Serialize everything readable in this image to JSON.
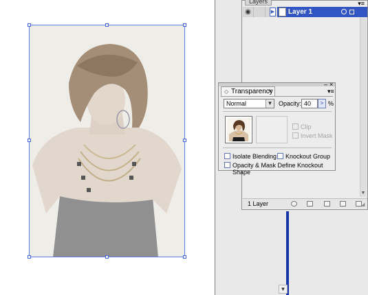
{
  "canvas": {
    "photo_alt": "",
    "selection_color": "#3d63d8"
  },
  "layers_panel": {
    "tab_label": "Layers",
    "menu_icon": "panel-menu-icon",
    "layer_name": "Layer 1",
    "layer_count": "1 Layer",
    "highlight_color": "#3156c4"
  },
  "transparency_panel": {
    "tab_arrow": "◇",
    "tab_label": "Transparency",
    "tab_close": "×",
    "blend_mode": "Normal",
    "opacity_label": "Opacity:",
    "opacity_value": "40",
    "opacity_unit": "%",
    "clip_label": "Clip",
    "invert_mask_label": "Invert Mask",
    "isolate_blending_label": "Isolate Blending",
    "knockout_group_label": "Knockout Group",
    "opacity_mask_label": "Opacity & Mask Define Knockout Shape"
  },
  "colors": {
    "dock_background": "#e9e9e9",
    "blue_accent": "#1535a8"
  }
}
